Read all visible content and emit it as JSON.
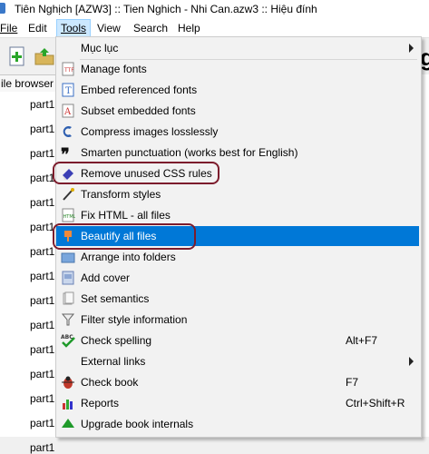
{
  "window": {
    "title": "Tiên Nghịch [AZW3] :: Tien Nghich - Nhi Can.azw3 :: Hiệu đính"
  },
  "menubar": [
    {
      "label": "File",
      "active": false
    },
    {
      "label": "Edit",
      "active": false
    },
    {
      "label": "Tools",
      "active": true
    },
    {
      "label": "View",
      "active": false
    },
    {
      "label": "Search",
      "active": false
    },
    {
      "label": "Help",
      "active": false
    }
  ],
  "file_browser": {
    "tab_label": "ile browser",
    "items": [
      "part1",
      "part1",
      "part1",
      "part1",
      "part1",
      "part1",
      "part1",
      "part1",
      "part1",
      "part1",
      "part1",
      "part1",
      "part1",
      "part1",
      "part1"
    ]
  },
  "tools_menu": {
    "items": [
      {
        "label": "Mục lục",
        "icon": "blank-icon",
        "submenu": true,
        "shortcut": ""
      },
      {
        "label": "Manage fonts",
        "icon": "font-file-icon",
        "submenu": false,
        "shortcut": ""
      },
      {
        "label": "Embed referenced fonts",
        "icon": "embed-font-icon",
        "submenu": false,
        "shortcut": ""
      },
      {
        "label": "Subset embedded fonts",
        "icon": "subset-font-icon",
        "submenu": false,
        "shortcut": ""
      },
      {
        "label": "Compress images losslessly",
        "icon": "compress-icon",
        "submenu": false,
        "shortcut": ""
      },
      {
        "label": "Smarten punctuation (works best for English)",
        "icon": "quote-icon",
        "submenu": false,
        "shortcut": ""
      },
      {
        "label": "Remove unused CSS rules",
        "icon": "eraser-icon",
        "submenu": false,
        "shortcut": ""
      },
      {
        "label": "Transform styles",
        "icon": "wand-icon",
        "submenu": false,
        "shortcut": ""
      },
      {
        "label": "Fix HTML - all files",
        "icon": "html-icon",
        "submenu": false,
        "shortcut": ""
      },
      {
        "label": "Beautify all files",
        "icon": "beautify-icon",
        "submenu": false,
        "shortcut": "",
        "highlighted": true
      },
      {
        "label": "Arrange into folders",
        "icon": "folders-icon",
        "submenu": false,
        "shortcut": ""
      },
      {
        "label": "Add cover",
        "icon": "cover-icon",
        "submenu": false,
        "shortcut": ""
      },
      {
        "label": "Set semantics",
        "icon": "semantics-icon",
        "submenu": false,
        "shortcut": ""
      },
      {
        "label": "Filter style information",
        "icon": "filter-icon",
        "submenu": false,
        "shortcut": ""
      },
      {
        "label": "Check spelling",
        "icon": "spellcheck-icon",
        "submenu": false,
        "shortcut": "Alt+F7"
      },
      {
        "label": "External links",
        "icon": "blank-icon",
        "submenu": true,
        "shortcut": ""
      },
      {
        "label": "Check book",
        "icon": "bug-icon",
        "submenu": false,
        "shortcut": "F7"
      },
      {
        "label": "Reports",
        "icon": "reports-icon",
        "submenu": false,
        "shortcut": "Ctrl+Shift+R"
      },
      {
        "label": "Upgrade book internals",
        "icon": "upgrade-icon",
        "submenu": false,
        "shortcut": ""
      }
    ]
  },
  "colors": {
    "highlight": "#0078d7",
    "annotation": "#7c1c2c",
    "menu_bg": "#f2f2f2"
  }
}
